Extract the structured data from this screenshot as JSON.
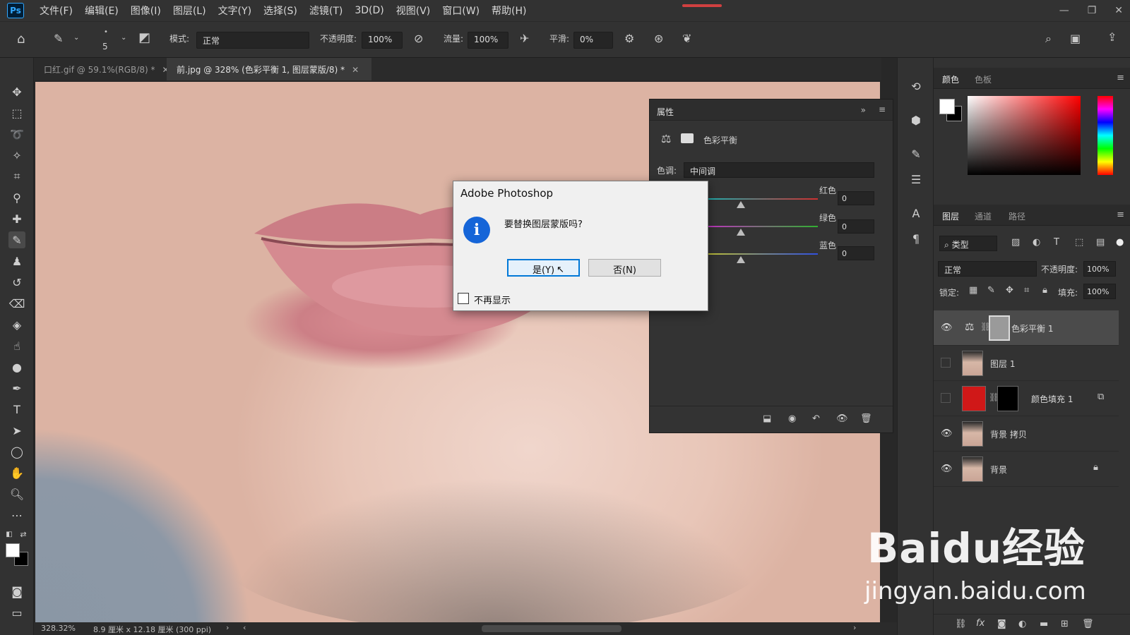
{
  "app": {
    "logo": "Ps"
  },
  "menu": [
    "文件(F)",
    "编辑(E)",
    "图像(I)",
    "图层(L)",
    "文字(Y)",
    "选择(S)",
    "滤镜(T)",
    "3D(D)",
    "视图(V)",
    "窗口(W)",
    "帮助(H)"
  ],
  "options": {
    "brush_size": "5",
    "mode_label": "模式:",
    "mode_value": "正常",
    "opacity_label": "不透明度:",
    "opacity_value": "100%",
    "flow_label": "流量:",
    "flow_value": "100%",
    "smooth_label": "平滑:",
    "smooth_value": "0%"
  },
  "tabs": [
    {
      "label": "口红.gif @ 59.1%(RGB/8) *",
      "close": "✕"
    },
    {
      "label": "前.jpg @ 328% (色彩平衡 1, 图层蒙版/8) *",
      "close": "✕"
    }
  ],
  "properties": {
    "title": "属性",
    "adjustment_name": "色彩平衡",
    "tone_label": "色调:",
    "tone_value": "中间调",
    "sliders": [
      {
        "label": "红色",
        "value": "0",
        "color": "#d03030"
      },
      {
        "label": "绿色",
        "value": "0",
        "color": "#30b030"
      },
      {
        "label": "蓝色",
        "value": "0",
        "color": "#3050e0"
      }
    ]
  },
  "dialog": {
    "title": "Adobe Photoshop",
    "message": "要替换图层蒙版吗?",
    "yes_label": "是(Y)",
    "no_label": "否(N)",
    "checkbox_label": "不再显示",
    "checked": false
  },
  "color_panel": {
    "tabs": [
      "颜色",
      "色板"
    ],
    "fg": "#ffffff",
    "bg": "#000000",
    "hue": "#ff0000"
  },
  "layers_panel": {
    "tabs": [
      "图层",
      "通道",
      "路径"
    ],
    "filter_label": "类型",
    "blend_mode": "正常",
    "opacity_label": "不透明度:",
    "opacity_value": "100%",
    "lock_label": "锁定:",
    "fill_label": "填充:",
    "fill_value": "100%",
    "layers": [
      {
        "name": "色彩平衡 1",
        "visible": true,
        "selected": true
      },
      {
        "name": "图层 1",
        "visible": false,
        "selected": false
      },
      {
        "name": "颜色填充 1",
        "visible": false,
        "selected": false
      },
      {
        "name": "背景 拷贝",
        "visible": true,
        "selected": false
      },
      {
        "name": "背景",
        "visible": true,
        "selected": false,
        "locked": true
      }
    ]
  },
  "status": {
    "zoom": "328.32%",
    "doc_info": "8.9 厘米 x 12.18 厘米 (300 ppi)"
  },
  "watermark": {
    "brand": "Baidu经验",
    "url": "jingyan.baidu.com"
  }
}
